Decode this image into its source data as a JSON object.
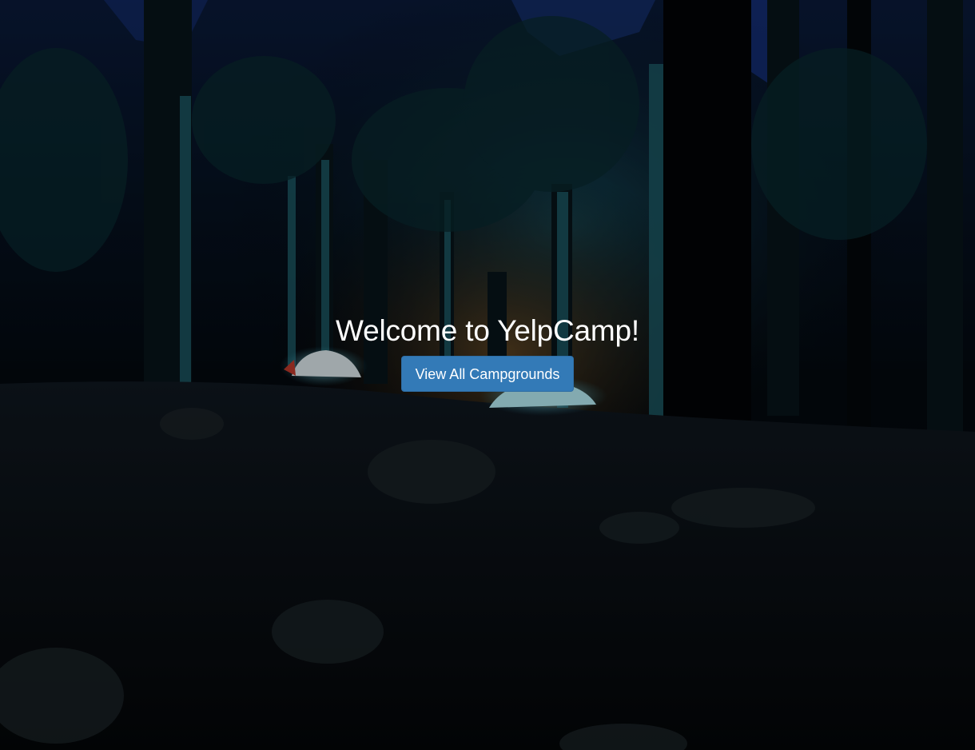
{
  "landing": {
    "heading": "Welcome to YelpCamp!",
    "cta_label": "View All Campgrounds"
  },
  "theme": {
    "button_color": "#337ab7",
    "heading_color": "#ffffff"
  },
  "background": {
    "icon": "forest-campsite-night-photo"
  }
}
